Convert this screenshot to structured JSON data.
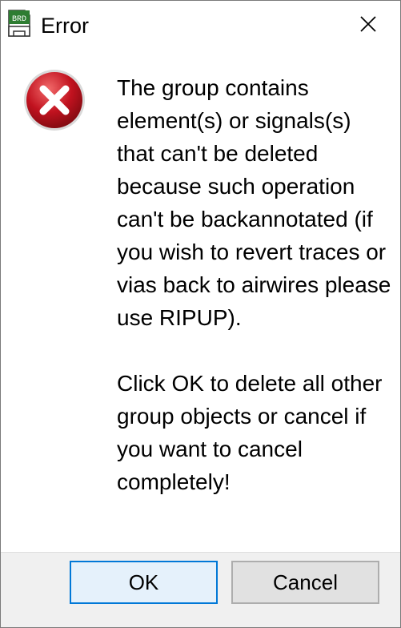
{
  "window": {
    "title": "Error",
    "app_icon_text": "BRD"
  },
  "message": {
    "text": "The group contains element(s) or signals(s) that can't be deleted because such operation can't be backannotated (if you wish to revert traces or vias back to airwires please use RIPUP).\n\nClick OK to delete all other group objects or cancel if you want to cancel completely!"
  },
  "buttons": {
    "ok_label": "OK",
    "cancel_label": "Cancel"
  },
  "icons": {
    "app": "brd-app-icon",
    "error": "error-icon",
    "close": "close-icon"
  },
  "colors": {
    "error_red": "#c1121f",
    "app_green": "#2e7d32",
    "focus_blue": "#0078d7"
  }
}
